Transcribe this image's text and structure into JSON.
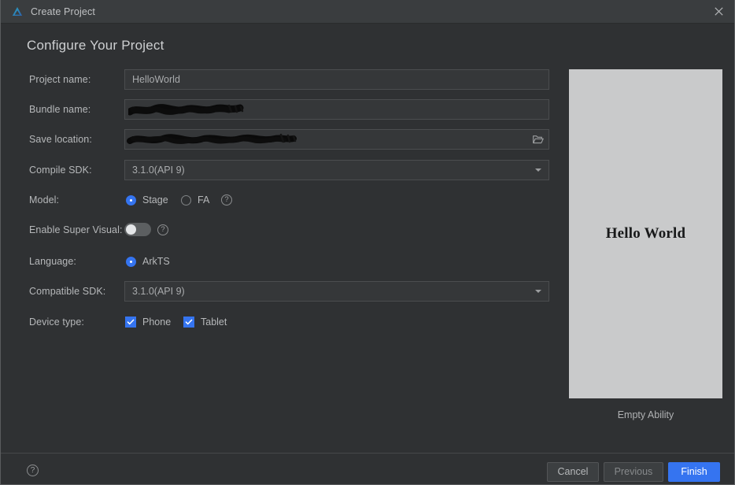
{
  "window": {
    "title": "Create Project",
    "app_icon": "deveco-logo-icon",
    "close_icon": "close-icon"
  },
  "page": {
    "heading": "Configure Your Project"
  },
  "form": {
    "project_name": {
      "label": "Project name:",
      "value": "HelloWorld"
    },
    "bundle_name": {
      "label": "Bundle name:",
      "value": "",
      "redacted": true
    },
    "save_location": {
      "label": "Save location:",
      "value": "",
      "redacted": true,
      "browse_icon": "folder-open-icon"
    },
    "compile_sdk": {
      "label": "Compile SDK:",
      "value": "3.1.0(API 9)",
      "dropdown_icon": "chevron-down-icon"
    },
    "model": {
      "label": "Model:",
      "options": [
        {
          "label": "Stage",
          "selected": true
        },
        {
          "label": "FA",
          "selected": false
        }
      ],
      "help_icon": "help-circle-icon",
      "help_glyph": "?"
    },
    "super_visual": {
      "label": "Enable Super Visual:",
      "enabled": false,
      "help_icon": "help-circle-icon",
      "help_glyph": "?"
    },
    "language": {
      "label": "Language:",
      "options": [
        {
          "label": "ArkTS",
          "selected": true
        }
      ]
    },
    "compatible_sdk": {
      "label": "Compatible SDK:",
      "value": "3.1.0(API 9)",
      "dropdown_icon": "chevron-down-icon"
    },
    "device_type": {
      "label": "Device type:",
      "options": [
        {
          "label": "Phone",
          "checked": true
        },
        {
          "label": "Tablet",
          "checked": true
        }
      ]
    }
  },
  "preview": {
    "screen_text": "Hello World",
    "caption": "Empty Ability"
  },
  "footer": {
    "help_icon": "help-circle-icon",
    "help_glyph": "?",
    "cancel_label": "Cancel",
    "previous_label": "Previous",
    "finish_label": "Finish"
  },
  "colors": {
    "accent": "#3574f0",
    "window_bg": "#2f3133",
    "titlebar_bg": "#3a3d3f",
    "field_bg": "#353739",
    "preview_bg": "#c9cacb"
  }
}
